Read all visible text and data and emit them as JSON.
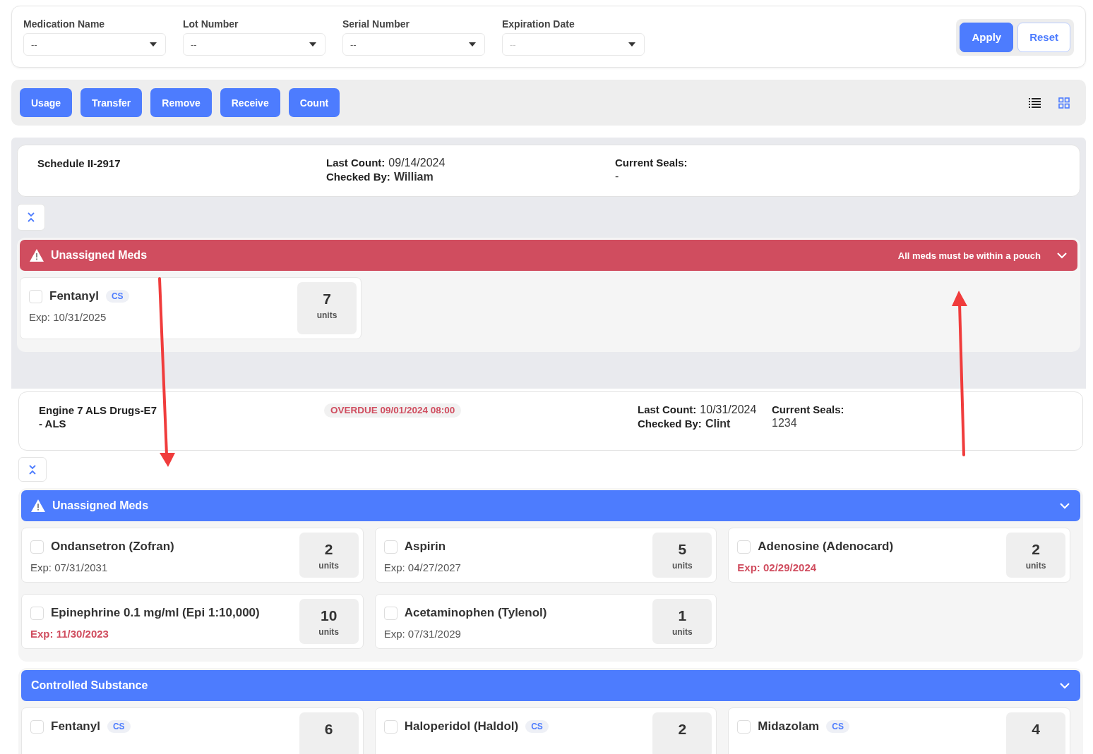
{
  "filters": [
    {
      "label": "Medication Name",
      "value": "--"
    },
    {
      "label": "Lot Number",
      "value": "--"
    },
    {
      "label": "Serial Number",
      "value": "--"
    },
    {
      "label": "Expiration Date",
      "placeholder": "--"
    }
  ],
  "filter_buttons": [
    {
      "label": "Apply",
      "kind": "primary"
    },
    {
      "label": "Reset",
      "kind": "outline"
    }
  ],
  "actions": [
    "Usage",
    "Transfer",
    "Remove",
    "Receive",
    "Count"
  ],
  "view_toggle": [
    {
      "kind": "list",
      "selected": false
    },
    {
      "kind": "grid",
      "selected": true
    }
  ],
  "sections": [
    {
      "title": "Schedule II-2917",
      "last_count_label": "Last Count:",
      "last_count": "09/14/2024",
      "checked_by_label": "Checked By:",
      "checked_by": "William",
      "seals_label": "Current Seals:",
      "seals": "-",
      "groups": [
        {
          "title": "Unassigned Meds",
          "alert": true,
          "color": "#d04d5f",
          "note": "All meds must be within a pouch",
          "items": [
            {
              "name": "Fentanyl",
              "badge": "CS",
              "checked": false,
              "exp": "Exp: 10/31/2025",
              "expired": false,
              "qty": "7",
              "unit": "units"
            }
          ]
        }
      ]
    },
    {
      "title": "Engine 7 ALS Drugs-E7 - ALS",
      "overdue": "OVERDUE 09/01/2024 08:00",
      "last_count_label": "Last Count:",
      "last_count": "10/31/2024",
      "checked_by_label": "Checked By:",
      "checked_by": "Clint",
      "seals_label": "Current Seals:",
      "seals": "1234",
      "groups": [
        {
          "title": "Unassigned Meds",
          "alert": true,
          "color": "#4d7cfe",
          "items": [
            {
              "name": "Ondansetron (Zofran)",
              "checked": false,
              "exp": "Exp: 07/31/2031",
              "expired": false,
              "qty": "2",
              "unit": "units"
            },
            {
              "name": "Aspirin",
              "checked": false,
              "exp": "Exp: 04/27/2027",
              "expired": false,
              "qty": "5",
              "unit": "units"
            },
            {
              "name": "Adenosine (Adenocard)",
              "checked": false,
              "exp": "Exp: 02/29/2024",
              "expired": true,
              "qty": "2",
              "unit": "units"
            },
            {
              "name": "Epinephrine 0.1 mg/ml (Epi 1:10,000)",
              "checked": false,
              "exp": "Exp: 11/30/2023",
              "expired": true,
              "qty": "10",
              "unit": "units"
            },
            {
              "name": "Acetaminophen (Tylenol)",
              "checked": false,
              "exp": "Exp: 07/31/2029",
              "expired": false,
              "qty": "1",
              "unit": "units"
            }
          ]
        },
        {
          "title": "Controlled Substance",
          "alert": false,
          "color": "#4d7cfe",
          "items": [
            {
              "name": "Fentanyl",
              "badge": "CS",
              "checked": false,
              "qty": "6"
            },
            {
              "name": "Haloperidol (Haldol)",
              "badge": "CS",
              "checked": false,
              "qty": "2"
            },
            {
              "name": "Midazolam",
              "badge": "CS",
              "checked": false,
              "qty": "4"
            }
          ]
        }
      ]
    }
  ]
}
